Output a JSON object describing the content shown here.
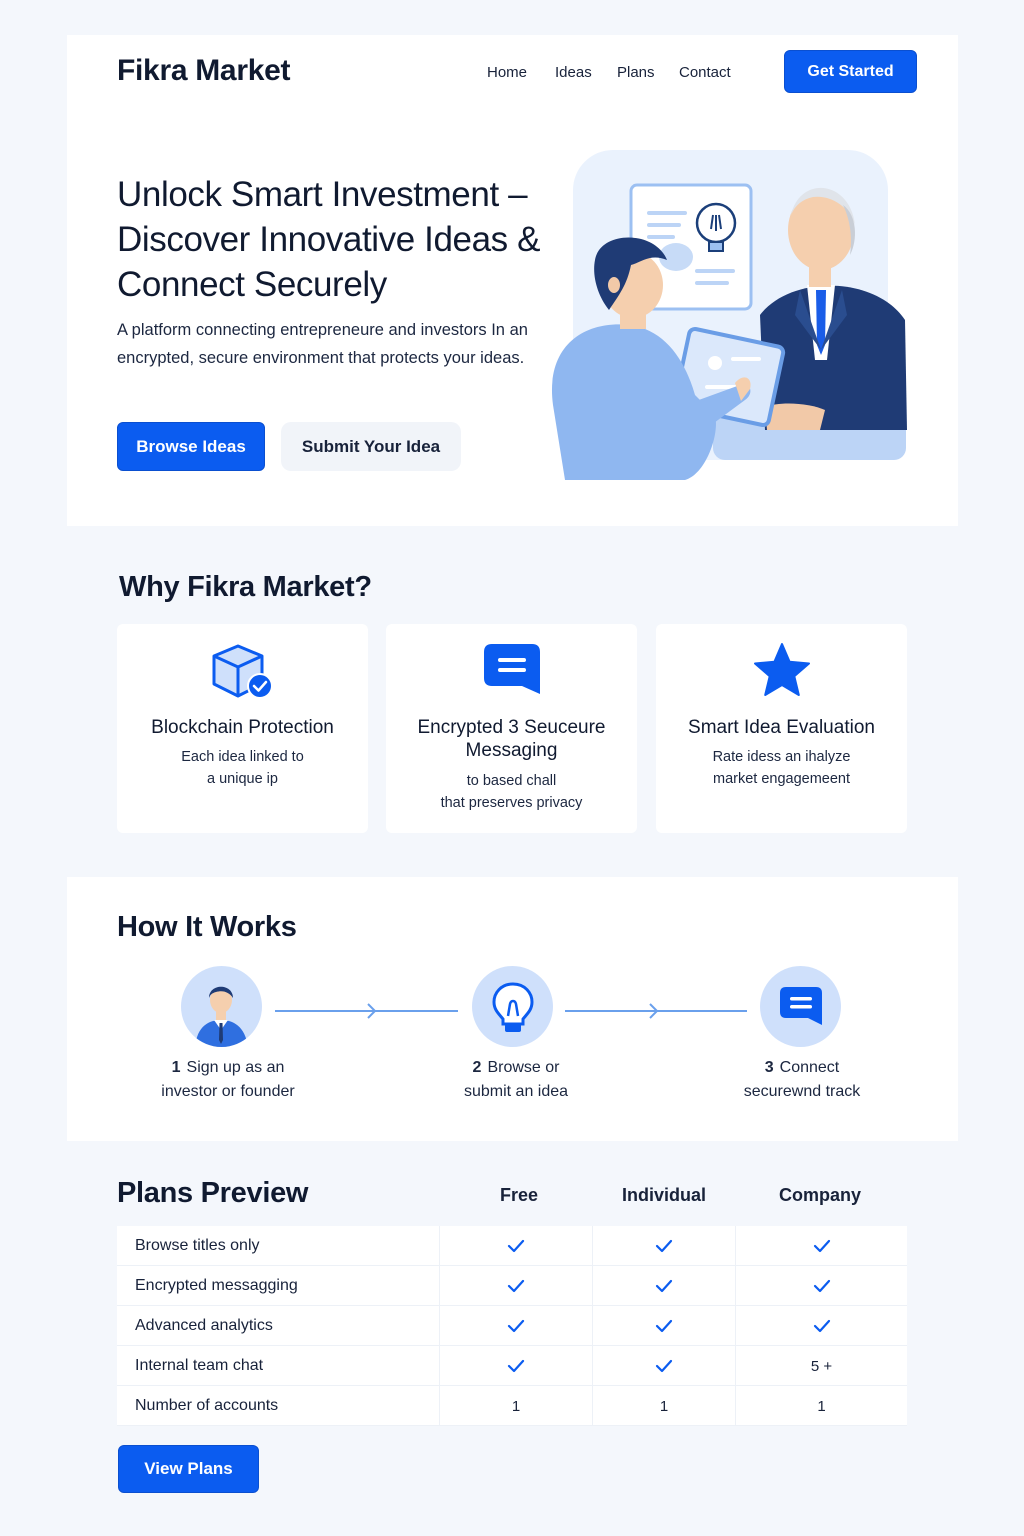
{
  "header": {
    "brand": "Fikra Market",
    "nav": [
      "Home",
      "Ideas",
      "Plans",
      "Contact"
    ],
    "cta": "Get Started"
  },
  "hero": {
    "title": "Unlock Smart Investment – Discover Innovative Ideas & Connect Securely",
    "description": "A platform connecting entrepreneure and investors In an encrypted, secure environment that protects your ideas.",
    "primary_button": "Browse Ideas",
    "secondary_button": "Submit Your Idea"
  },
  "features": {
    "title": "Why Fikra Market?",
    "items": [
      {
        "icon": "cube-check-icon",
        "title": "Blockchain Protection",
        "desc": "Each idea linked to\na unique ip"
      },
      {
        "icon": "chat-bubble-icon",
        "title": "Encrypted 3 Seuceure\nMessaging",
        "desc": "to  based chall\nthat preserves privacy"
      },
      {
        "icon": "star-icon",
        "title": "Smart Idea Evaluation",
        "desc": "Rate idess an ihalyze\nmarket engagemeent"
      }
    ]
  },
  "how": {
    "title": "How It Works",
    "steps": [
      {
        "num": "1",
        "icon": "user-avatar-icon",
        "label": "Sign up as an\ninvestor or founder"
      },
      {
        "num": "2",
        "icon": "lightbulb-icon",
        "label": "Browse or\nsubmit an idea"
      },
      {
        "num": "3",
        "icon": "chat-bubble-icon",
        "label": "Connect\nsecurewnd track"
      }
    ]
  },
  "plans": {
    "title": "Plans Preview",
    "columns": [
      "Free",
      "Individual",
      "Company"
    ],
    "rows": [
      {
        "feature": "Browse titles only",
        "values": [
          "check",
          "check",
          "check"
        ]
      },
      {
        "feature": "Encrypted messagging",
        "values": [
          "check",
          "check",
          "check"
        ]
      },
      {
        "feature": "Advanced analytics",
        "values": [
          "check",
          "check",
          "check"
        ]
      },
      {
        "feature": "Internal team chat",
        "values": [
          "check",
          "check",
          "5 +"
        ]
      },
      {
        "feature": "Number of accounts",
        "values": [
          "1",
          "1",
          "1"
        ]
      }
    ],
    "button": "View Plans"
  },
  "colors": {
    "accent": "#0b5cf0",
    "light_blue": "#cfe0fb",
    "background": "#f4f7fc"
  }
}
